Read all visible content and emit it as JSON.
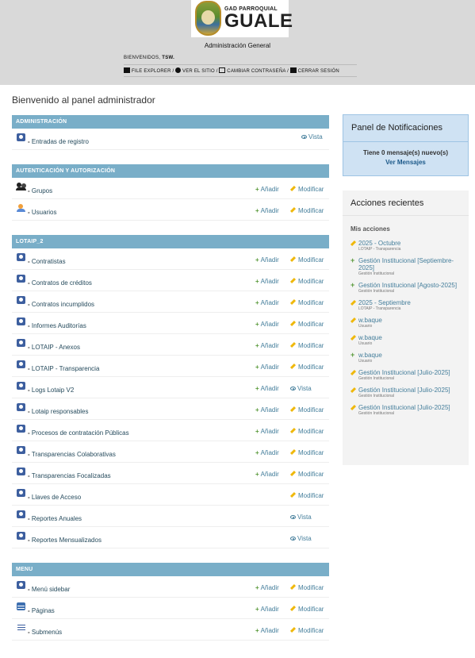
{
  "header": {
    "logo_small": "GAD PARROQUIAL",
    "logo_big": "GUALE",
    "subtitle": "Administración General",
    "welcome_prefix": "BIENVENIDOS,",
    "username": "TSW.",
    "links": [
      {
        "label": "FILE EXPLORER /",
        "icon": "folder-icon"
      },
      {
        "label": "VER EL SITIO /",
        "icon": "globe-icon"
      },
      {
        "label": "CAMBIAR CONTRASEÑA /",
        "icon": "key-icon"
      },
      {
        "label": "CERRAR SESIÓN",
        "icon": "logout-icon"
      }
    ]
  },
  "page_title": "Bienvenido al panel administrador",
  "modules": [
    {
      "caption": "Administración",
      "rows": [
        {
          "name": "Entradas de registro",
          "view": "Vista",
          "icon": "gear-icon"
        }
      ]
    },
    {
      "caption": "Autenticación y autorización",
      "rows": [
        {
          "name": "Grupos",
          "add": "Añadir",
          "change": "Modificar",
          "icon": "users-icon"
        },
        {
          "name": "Usuarios",
          "add": "Añadir",
          "change": "Modificar",
          "icon": "person-icon"
        }
      ]
    },
    {
      "caption": "Lotaip_2",
      "rows": [
        {
          "name": "Contratistas",
          "add": "Añadir",
          "change": "Modificar",
          "icon": "gear-icon"
        },
        {
          "name": "Contratos de créditos",
          "add": "Añadir",
          "change": "Modificar",
          "icon": "gear-icon"
        },
        {
          "name": "Contratos incumplidos",
          "add": "Añadir",
          "change": "Modificar",
          "icon": "gear-icon"
        },
        {
          "name": "Informes Auditorías",
          "add": "Añadir",
          "change": "Modificar",
          "icon": "gear-icon"
        },
        {
          "name": "LOTAIP - Anexos",
          "add": "Añadir",
          "change": "Modificar",
          "icon": "gear-icon"
        },
        {
          "name": "LOTAIP - Transparencia",
          "add": "Añadir",
          "change": "Modificar",
          "icon": "gear-icon"
        },
        {
          "name": "Logs Lotaip V2",
          "add": "Añadir",
          "view": "Vista",
          "icon": "gear-icon"
        },
        {
          "name": "Lotaip responsables",
          "add": "Añadir",
          "change": "Modificar",
          "icon": "gear-icon"
        },
        {
          "name": "Procesos de contratación Públicas",
          "add": "Añadir",
          "change": "Modificar",
          "icon": "gear-icon"
        },
        {
          "name": "Transparencias Colaborativas",
          "add": "Añadir",
          "change": "Modificar",
          "icon": "gear-icon"
        },
        {
          "name": "Transparencias Focalizadas",
          "add": "Añadir",
          "change": "Modificar",
          "icon": "gear-icon"
        },
        {
          "name": "Llaves de Acceso",
          "change": "Modificar",
          "icon": "gear-icon"
        },
        {
          "name": "Reportes Anuales",
          "view": "Vista",
          "icon": "gear-icon"
        },
        {
          "name": "Reportes Mensualizados",
          "view": "Vista",
          "icon": "gear-icon"
        }
      ]
    },
    {
      "caption": "Menu",
      "rows": [
        {
          "name": "Menú sidebar",
          "add": "Añadir",
          "change": "Modificar",
          "icon": "gear-icon"
        },
        {
          "name": "Páginas",
          "add": "Añadir",
          "change": "Modificar",
          "icon": "table-icon"
        },
        {
          "name": "Submenús",
          "add": "Añadir",
          "change": "Modificar",
          "icon": "list-icon"
        }
      ]
    }
  ],
  "notifications": {
    "title": "Panel de Notificaciones",
    "message": "Tiene 0 mensaje(s) nuevo(s)",
    "link": "Ver Mensajes"
  },
  "recent_actions": {
    "title": "Acciones recientes",
    "subtitle": "Mis acciones",
    "items": [
      {
        "action": "change",
        "name": "2025 - Octubre",
        "type": "LOTAIP - Transparencia"
      },
      {
        "action": "add",
        "name": "Gestión Institucional [Septiembre-2025]",
        "type": "Gestión Institucional"
      },
      {
        "action": "add",
        "name": "Gestión Institucional [Agosto-2025]",
        "type": "Gestión Institucional"
      },
      {
        "action": "change",
        "name": "2025 - Septiembre",
        "type": "LOTAIP - Transparencia"
      },
      {
        "action": "change",
        "name": "w.baque",
        "type": "Usuario"
      },
      {
        "action": "change",
        "name": "w.baque",
        "type": "Usuario"
      },
      {
        "action": "add",
        "name": "w.baque",
        "type": "Usuario"
      },
      {
        "action": "change",
        "name": "Gestión Institucional [Julio-2025]",
        "type": "Gestión Institucional"
      },
      {
        "action": "change",
        "name": "Gestión Institucional [Julio-2025]",
        "type": "Gestión Institucional"
      },
      {
        "action": "change",
        "name": "Gestión Institucional [Julio-2025]",
        "type": "Gestión Institucional"
      }
    ]
  },
  "colors": {
    "header_bg": "#d9d9d9",
    "module_caption": "#79aec8",
    "link": "#447e9b",
    "notif_bg": "#cfe2f3"
  }
}
